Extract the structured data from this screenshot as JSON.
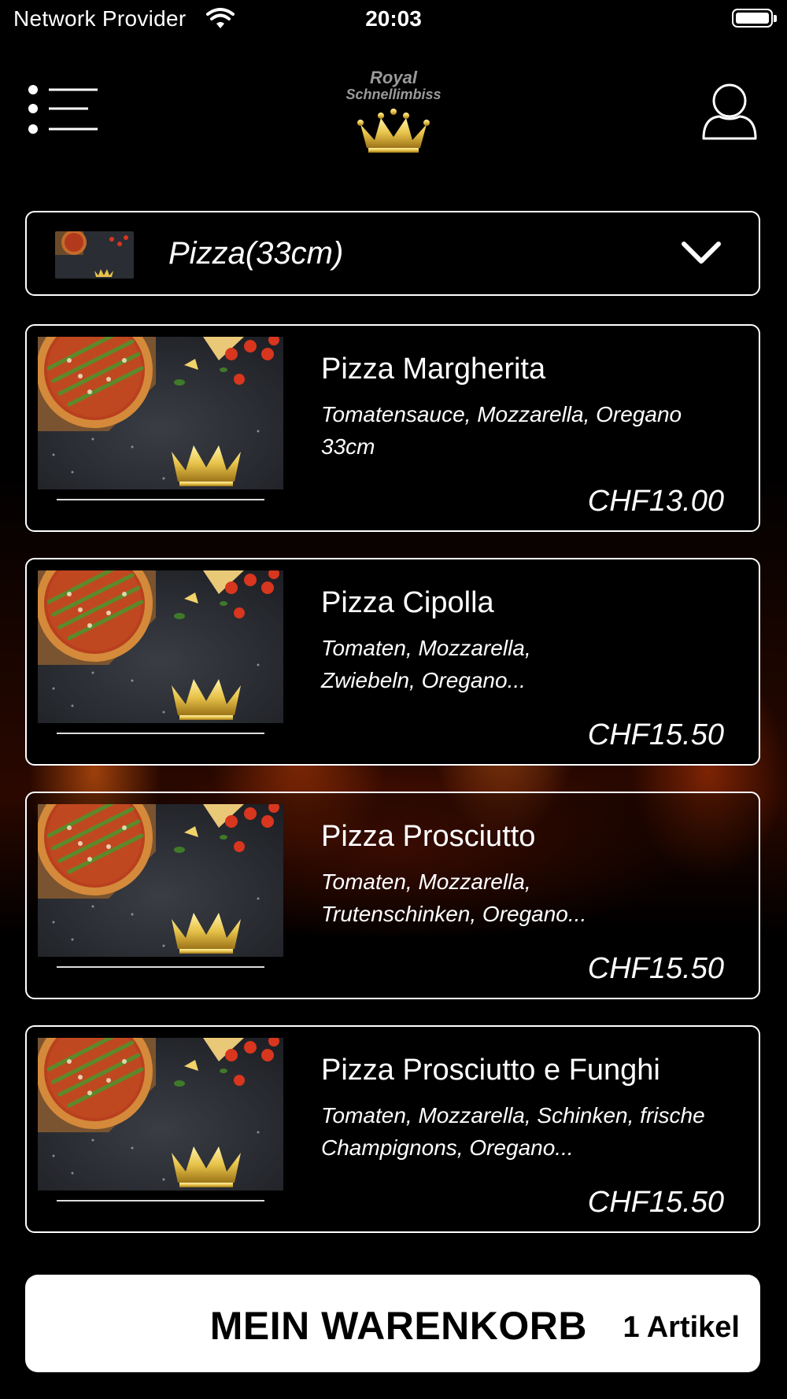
{
  "status_bar": {
    "carrier": "Network Provider",
    "time": "20:03"
  },
  "header": {
    "logo_line1": "Royal",
    "logo_line2": "Schnellimbiss"
  },
  "category": {
    "label": "Pizza(33cm)"
  },
  "products": [
    {
      "name": "Pizza Margherita",
      "desc1": "Tomatensauce, Mozzarella, Oregano",
      "desc2": "33cm",
      "price": "CHF13.00"
    },
    {
      "name": "Pizza Cipolla",
      "desc1": "Tomaten, Mozzarella,",
      "desc2": "Zwiebeln, Oregano...",
      "price": "CHF15.50"
    },
    {
      "name": "Pizza Prosciutto",
      "desc1": "Tomaten, Mozzarella,",
      "desc2": "Trutenschinken, Oregano...",
      "price": "CHF15.50"
    },
    {
      "name": "Pizza Prosciutto e Funghi",
      "desc1": "Tomaten, Mozzarella, Schinken, frische",
      "desc2": "Champignons, Oregano...",
      "price": "CHF15.50"
    }
  ],
  "cart": {
    "title": "MEIN WARENKORB",
    "count": "1 Artikel"
  },
  "colors": {
    "background": "#000000",
    "accent_gold": "#e8c34a",
    "text": "#ffffff"
  },
  "icons": [
    "wifi-icon",
    "battery-icon",
    "menu-icon",
    "crown-icon",
    "profile-icon",
    "chevron-down-icon"
  ]
}
